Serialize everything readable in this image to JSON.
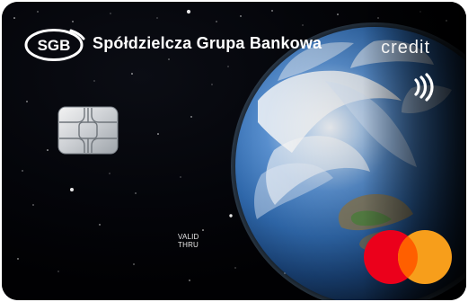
{
  "card": {
    "bank_logo_text": "SGB",
    "bank_name": "Spółdzielcza Grupa Bankowa",
    "card_type": "credit",
    "valid_label_line1": "VALID",
    "valid_label_line2": "THRU",
    "icons": {
      "logo": "sgb-logo-icon",
      "contactless": "contactless-icon",
      "chip": "chip-icon",
      "network": "mastercard-logo-icon"
    },
    "colors": {
      "background": "#020308",
      "text": "#ffffff",
      "mastercard_red": "#eb001b",
      "mastercard_orange": "#f79e1b",
      "mastercard_overlap": "#ff5f00",
      "earth_blue": "#2d6eb6"
    }
  }
}
